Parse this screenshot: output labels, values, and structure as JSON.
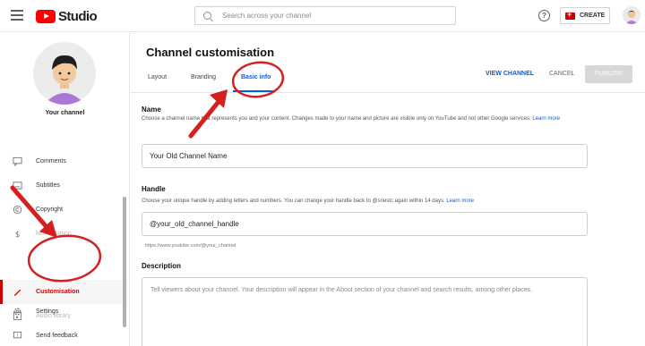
{
  "header": {
    "logo_text": "Studio",
    "search_placeholder": "Search across your channel",
    "help_glyph": "?",
    "create_label": "CREATE"
  },
  "sidebar": {
    "channel_label": "Your channel",
    "items": [
      {
        "label": "Comments",
        "icon": "comments-icon"
      },
      {
        "label": "Subtitles",
        "icon": "subtitles-icon"
      },
      {
        "label": "Copyright",
        "icon": "copyright-icon"
      },
      {
        "label": "Monetisation",
        "icon": "monetisation-icon"
      },
      {
        "label": "Customisation",
        "icon": "customisation-icon"
      },
      {
        "label": "Audio library",
        "icon": "audio-library-icon"
      },
      {
        "label": "Settings",
        "icon": "settings-icon"
      },
      {
        "label": "Send feedback",
        "icon": "send-feedback-icon"
      }
    ]
  },
  "main": {
    "title": "Channel customisation",
    "tabs": [
      {
        "label": "Layout"
      },
      {
        "label": "Branding"
      },
      {
        "label": "Basic info"
      }
    ],
    "active_tab": "Basic info",
    "actions": {
      "view_channel": "VIEW CHANNEL",
      "cancel": "CANCEL",
      "publish": "PUBLISH"
    },
    "name_section": {
      "heading": "Name",
      "description": "Choose a channel name that represents you and your content. Changes made to your name and picture are visible only on YouTube and not other Google services.",
      "link": "Learn more",
      "value": "Your Old Channel Name"
    },
    "handle_section": {
      "heading": "Handle",
      "description": "Choose your unique handle by adding letters and numbers. You can change your handle back to @sriestc again within 14 days.",
      "link": "Learn more",
      "value": "@your_old_channel_handle",
      "url": "https://www.youtube.com/@your_channel"
    },
    "description_section": {
      "heading": "Description",
      "placeholder": "Tell viewers about your channel. Your description will appear in the About section of your channel and search results, among other places."
    }
  },
  "colors": {
    "accent_blue": "#065fd4",
    "annotation_red": "#d62020",
    "active_nav_red": "#cc0000"
  }
}
